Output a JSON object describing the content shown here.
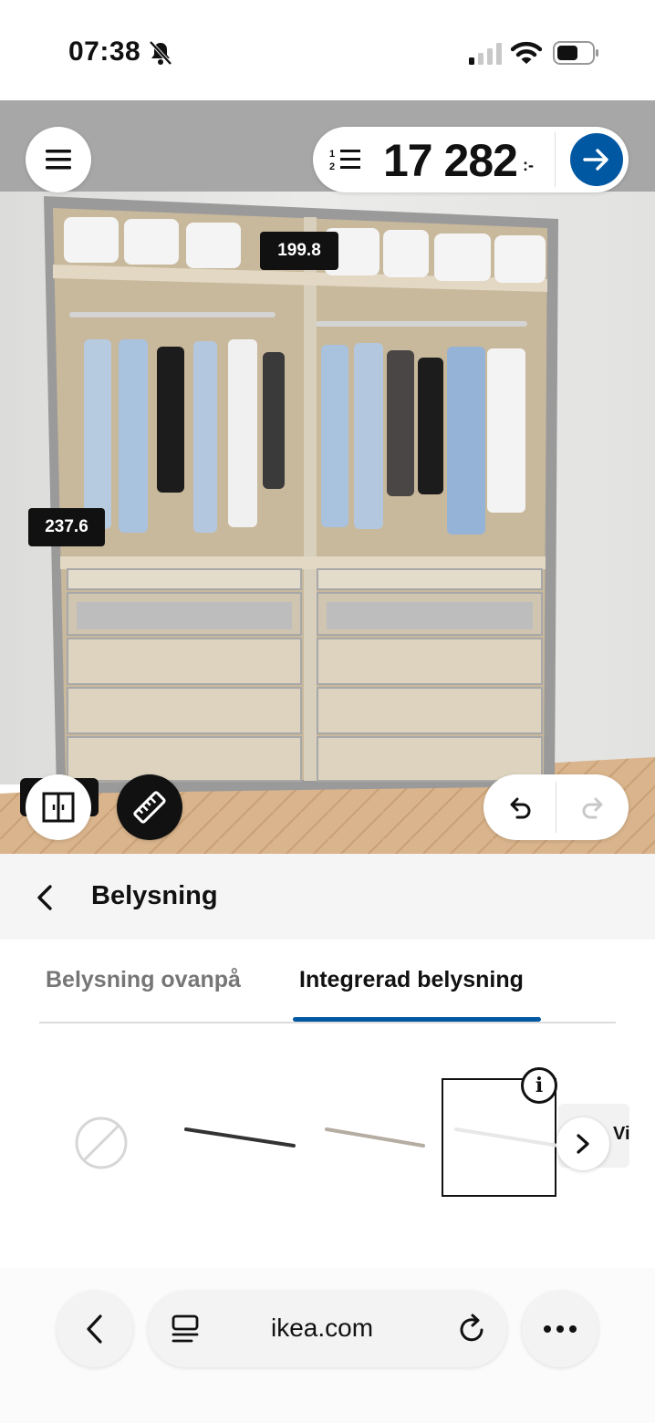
{
  "status": {
    "time": "07:38",
    "icons": [
      "bell-slash-icon",
      "signal-icon",
      "wifi-icon",
      "battery-icon"
    ]
  },
  "planner": {
    "menu_icon": "hamburger-icon",
    "list_icon": "numbered-list-icon",
    "price": "17 282",
    "price_suffix": ":-",
    "go_icon": "arrow-right-icon",
    "dimensions": {
      "width": "199.8",
      "height": "237.6"
    },
    "tools": [
      "wardrobe-doors-icon",
      "ruler-icon"
    ],
    "undo_icon": "undo-icon",
    "redo_icon": "redo-icon"
  },
  "section": {
    "title": "Belysning",
    "back_icon": "chevron-left-icon"
  },
  "tabs": [
    {
      "label": "Belysning ovanpå",
      "active": false
    },
    {
      "label": "Integrerad belysning",
      "active": true
    }
  ],
  "options": [
    {
      "name": "none",
      "icon": "no-selection-icon"
    },
    {
      "name": "black-led-strip"
    },
    {
      "name": "grey-led-strip"
    },
    {
      "name": "white-led-strip",
      "selected": true
    }
  ],
  "options_peek_text": "Vi",
  "browser": {
    "url": "ikea.com",
    "back_icon": "chevron-left-icon",
    "tabs_icon": "tabs-icon",
    "reload_icon": "reload-icon",
    "more_icon": "more-icon"
  },
  "colors": {
    "accent": "#0058a3",
    "dark": "#111111",
    "wall": "#e4e4e2",
    "floor": "#d7b088"
  }
}
